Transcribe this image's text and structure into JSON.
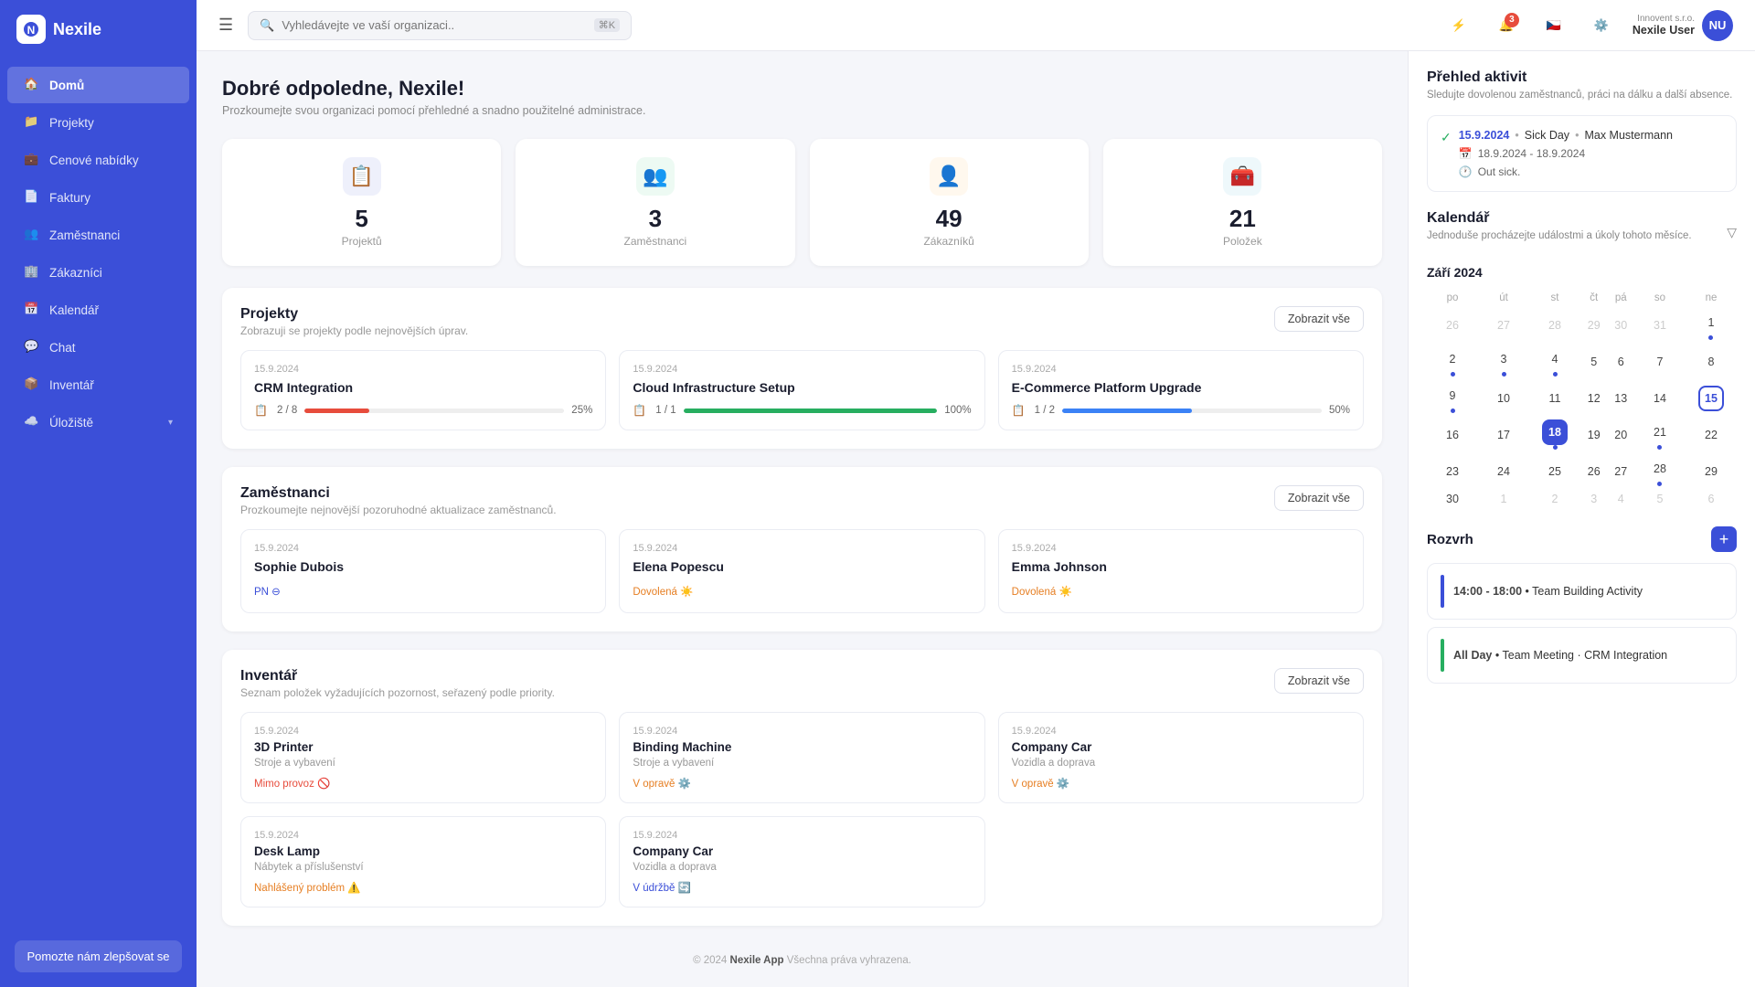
{
  "app": {
    "name": "Nexile",
    "logo_text": "N"
  },
  "header": {
    "search_placeholder": "Vyhledávejte ve vaší organizaci..",
    "search_shortcut": "⌘K",
    "user": {
      "company": "Innovent s.r.o.",
      "name": "Nexile User",
      "initials": "NU"
    },
    "notification_count": "3"
  },
  "sidebar": {
    "items": [
      {
        "id": "domu",
        "label": "Domů",
        "active": true
      },
      {
        "id": "projekty",
        "label": "Projekty",
        "active": false
      },
      {
        "id": "cenove-nabidky",
        "label": "Cenové nabídky",
        "active": false
      },
      {
        "id": "faktury",
        "label": "Faktury",
        "active": false
      },
      {
        "id": "zamestnanci",
        "label": "Zaměstnanci",
        "active": false
      },
      {
        "id": "zakaznici",
        "label": "Zákazníci",
        "active": false
      },
      {
        "id": "kalendar",
        "label": "Kalendář",
        "active": false
      },
      {
        "id": "chat",
        "label": "Chat",
        "active": false
      },
      {
        "id": "inventar",
        "label": "Inventář",
        "active": false
      },
      {
        "id": "uloziste",
        "label": "Úložiště",
        "active": false,
        "has_sub": true
      }
    ],
    "help_button": "Pomozte nám zlepšovat se"
  },
  "page": {
    "greeting": "Dobré odpoledne, Nexile!",
    "subtitle": "Prozkoumejte svou organizaci pomocí přehledné a snadno použitelné administrace."
  },
  "stats": [
    {
      "id": "projekty",
      "num": "5",
      "label": "Projektů",
      "icon": "📋",
      "bg": "#eef0fb"
    },
    {
      "id": "zamestnanci",
      "num": "3",
      "label": "Zaměstnanci",
      "icon": "👥",
      "bg": "#edfaf3"
    },
    {
      "id": "zakaznici",
      "num": "49",
      "label": "Zákazníků",
      "icon": "👤",
      "bg": "#fff8ee"
    },
    {
      "id": "polozky",
      "num": "21",
      "label": "Položek",
      "icon": "🧰",
      "bg": "#eef8fb"
    }
  ],
  "projects_section": {
    "title": "Projekty",
    "subtitle": "Zobrazuji se projekty podle nejnovějších úprav.",
    "show_all": "Zobrazit vše",
    "items": [
      {
        "date": "15.9.2024",
        "title": "CRM Integration",
        "tasks": "2 / 8",
        "progress": 25,
        "color": "#e74c3c"
      },
      {
        "date": "15.9.2024",
        "title": "Cloud Infrastructure Setup",
        "tasks": "1 / 1",
        "progress": 100,
        "color": "#27ae60"
      },
      {
        "date": "15.9.2024",
        "title": "E-Commerce Platform Upgrade",
        "tasks": "1 / 2",
        "progress": 50,
        "color": "#3b82f6"
      }
    ]
  },
  "employees_section": {
    "title": "Zaměstnanci",
    "subtitle": "Prozkoumejte nejnovější pozoruhodné aktualizace zaměstnanců.",
    "show_all": "Zobrazit vše",
    "items": [
      {
        "date": "15.9.2024",
        "name": "Sophie Dubois",
        "status": "PN",
        "status_type": "pn"
      },
      {
        "date": "15.9.2024",
        "name": "Elena Popescu",
        "status": "Dovolená",
        "status_type": "dovolena",
        "icon": "☀️"
      },
      {
        "date": "15.9.2024",
        "name": "Emma Johnson",
        "status": "Dovolená",
        "status_type": "dovolena",
        "icon": "☀️"
      }
    ]
  },
  "inventory_section": {
    "title": "Inventář",
    "subtitle": "Seznam položek vyžadujících pozornost, seřazený podle priority.",
    "show_all": "Zobrazit vše",
    "items": [
      {
        "date": "15.9.2024",
        "title": "3D Printer",
        "category": "Stroje a vybavení",
        "status": "Mimo provoz",
        "status_type": "red",
        "icon": "🚫"
      },
      {
        "date": "15.9.2024",
        "title": "Binding Machine",
        "category": "Stroje a vybavení",
        "status": "V opravě",
        "status_type": "orange",
        "icon": "⚙️"
      },
      {
        "date": "15.9.2024",
        "title": "Company Car",
        "category": "Vozidla a doprava",
        "status": "V opravě",
        "status_type": "orange",
        "icon": "⚙️"
      },
      {
        "date": "15.9.2024",
        "title": "Desk Lamp",
        "category": "Nábytek a příslušenství",
        "status": "Nahlášený problém",
        "status_type": "orange2",
        "icon": "⚠️"
      },
      {
        "date": "15.9.2024",
        "title": "Company Car",
        "category": "Vozidla a doprava",
        "status": "V údržbě",
        "status_type": "blue",
        "icon": "🔄"
      }
    ]
  },
  "activity_panel": {
    "title": "Přehled aktivit",
    "subtitle": "Sledujte dovolenou zaměstnanců, práci na dálku a další absence.",
    "entry": {
      "check": "✓",
      "date": "15.9.2024",
      "dot1": "•",
      "event": "Sick Day",
      "dot2": "•",
      "name": "Max Mustermann",
      "secondary_dates": "18.9.2024 - 18.9.2024",
      "secondary_note": "Out sick."
    }
  },
  "calendar": {
    "title": "Kalendář",
    "subtitle": "Jednoduše procházejte událostmi a úkoly tohoto měsíce.",
    "month_label": "Září 2024",
    "days_header": [
      "po",
      "út",
      "st",
      "čt",
      "pá",
      "so",
      "ne"
    ],
    "weeks": [
      [
        "26",
        "27",
        "28",
        "29",
        "30",
        "31",
        "1"
      ],
      [
        "2",
        "3",
        "4",
        "5",
        "6",
        "7",
        "8"
      ],
      [
        "9",
        "10",
        "11",
        "12",
        "13",
        "14",
        "15"
      ],
      [
        "16",
        "17",
        "18",
        "19",
        "20",
        "21",
        "22"
      ],
      [
        "23",
        "24",
        "25",
        "26",
        "27",
        "28",
        "29"
      ],
      [
        "30",
        "1",
        "2",
        "3",
        "4",
        "5",
        "6"
      ]
    ],
    "other_month_prev": [
      "26",
      "27",
      "28",
      "29",
      "30",
      "31"
    ],
    "other_month_next": [
      "1",
      "2",
      "3",
      "4",
      "5",
      "6"
    ],
    "selected_day": "18",
    "today_day": "15",
    "badges": {
      "3": "blue",
      "1_w1": "blue",
      "1_w1_ne": "blue",
      "2_w2": "blue",
      "3_w2": "blue",
      "1_w2": "blue",
      "2_w3": "blue",
      "21_w4": "blue",
      "28_w5": "blue"
    }
  },
  "schedule": {
    "title": "Rozvrh",
    "add_label": "+",
    "items": [
      {
        "time": "14:00 - 18:00",
        "dot": "•",
        "event": "Team Building Activity",
        "color": "#3b4fd8"
      },
      {
        "time": "All Day",
        "dot": "•",
        "event": "Team Meeting · CRM Integration",
        "color": "#27ae60"
      }
    ]
  },
  "footer": {
    "copy": "© 2024",
    "app_name": "Nexile App",
    "rights": "Všechna práva vyhrazena."
  }
}
